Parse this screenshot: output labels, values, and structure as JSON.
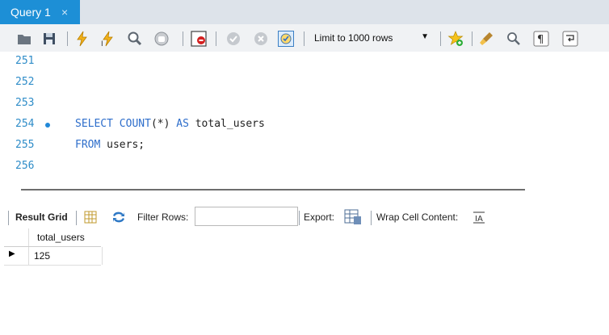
{
  "tab": {
    "label": "Query 1",
    "close_glyph": "×"
  },
  "toolbar": {
    "limit_label": "Limit to 1000 rows",
    "icons": [
      "open-folder-icon",
      "save-icon",
      "execute-icon",
      "execute-current-icon",
      "explain-icon",
      "stop-icon",
      "toggle-error-icon",
      "commit-icon",
      "rollback-icon",
      "autocommit-icon",
      "beautify-icon",
      "find-icon",
      "invisible-chars-icon",
      "wrap-icon"
    ]
  },
  "editor": {
    "lines": [
      {
        "num": "251",
        "code": ""
      },
      {
        "num": "252",
        "code": ""
      },
      {
        "num": "253",
        "code": ""
      },
      {
        "num": "254",
        "code": "SELECT COUNT(*) AS total_users"
      },
      {
        "num": "255",
        "code": "FROM users;"
      },
      {
        "num": "256",
        "code": ""
      }
    ]
  },
  "results": {
    "result_grid_label": "Result Grid",
    "filter_label": "Filter Rows:",
    "filter_value": "",
    "export_label": "Export:",
    "wrap_label": "Wrap Cell Content:",
    "columns": [
      "total_users"
    ],
    "rows": [
      [
        "125"
      ]
    ]
  }
}
